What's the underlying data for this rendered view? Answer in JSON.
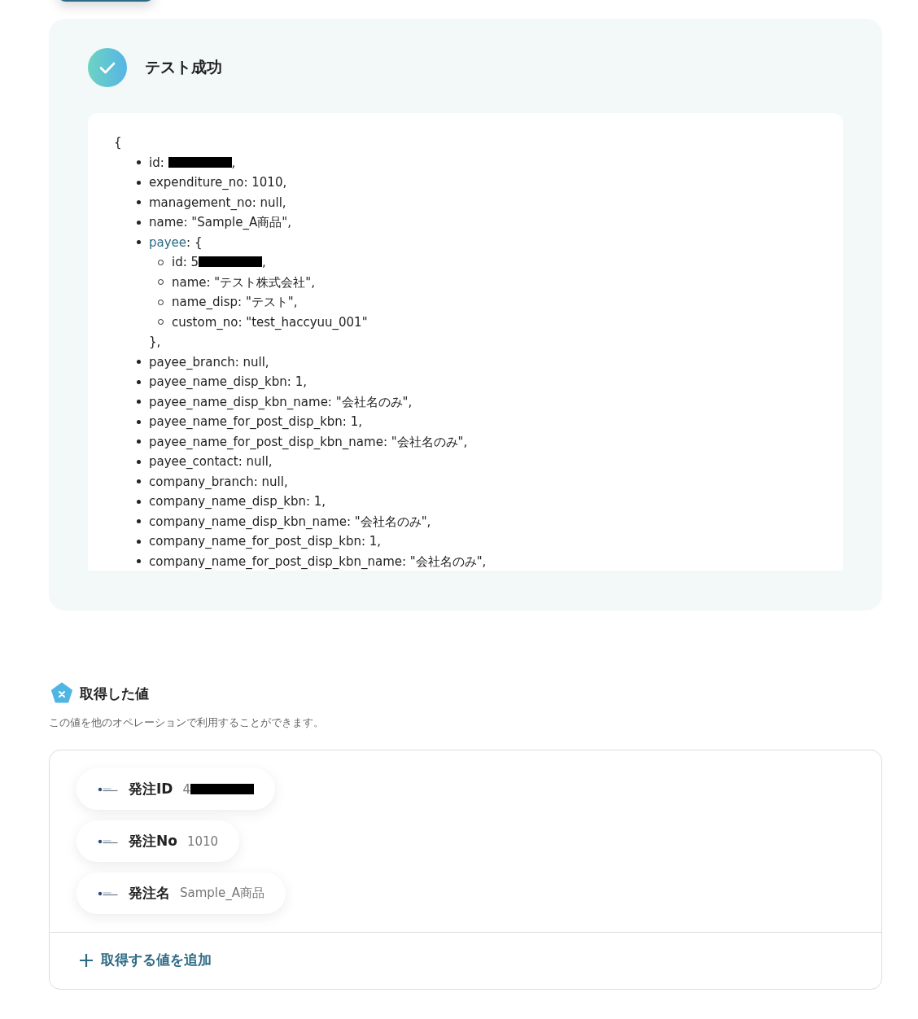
{
  "result_card": {
    "title": "テスト成功",
    "json_open": "{",
    "lines": [
      {
        "text": "id: ",
        "redacted": true,
        "tail": ","
      },
      {
        "text": "expenditure_no: 1010,"
      },
      {
        "text": "management_no: null,"
      },
      {
        "text": "name: \"Sample_A商品\","
      },
      {
        "key": "payee",
        "text": ": {",
        "close": "},",
        "children": [
          {
            "text": "id: 5",
            "redacted": true,
            "tail": ","
          },
          {
            "text": "name: \"テスト株式会社\","
          },
          {
            "text": "name_disp: \"テスト\","
          },
          {
            "text": "custom_no: \"test_haccyuu_001\""
          }
        ]
      },
      {
        "text": "payee_branch: null,"
      },
      {
        "text": "payee_name_disp_kbn: 1,"
      },
      {
        "text": "payee_name_disp_kbn_name: \"会社名のみ\","
      },
      {
        "text": "payee_name_for_post_disp_kbn: 1,"
      },
      {
        "text": "payee_name_for_post_disp_kbn_name: \"会社名のみ\","
      },
      {
        "text": "payee_contact: null,"
      },
      {
        "text": "company_branch: null,"
      },
      {
        "text": "company_name_disp_kbn: 1,"
      },
      {
        "text": "company_name_disp_kbn_name: \"会社名のみ\","
      },
      {
        "text": "company_name_for_post_disp_kbn: 1,"
      },
      {
        "text": "company_name_for_post_disp_kbn_name: \"会社名のみ\","
      }
    ]
  },
  "values_section": {
    "title": "取得した値",
    "description": "この値を他のオペレーションで利用することができます。",
    "chips": [
      {
        "label": "発注ID",
        "value": "4",
        "redacted": true
      },
      {
        "label": "発注No",
        "value": "1010"
      },
      {
        "label": "発注名",
        "value": "Sample_A商品"
      }
    ],
    "add_link": "取得する値を追加"
  }
}
